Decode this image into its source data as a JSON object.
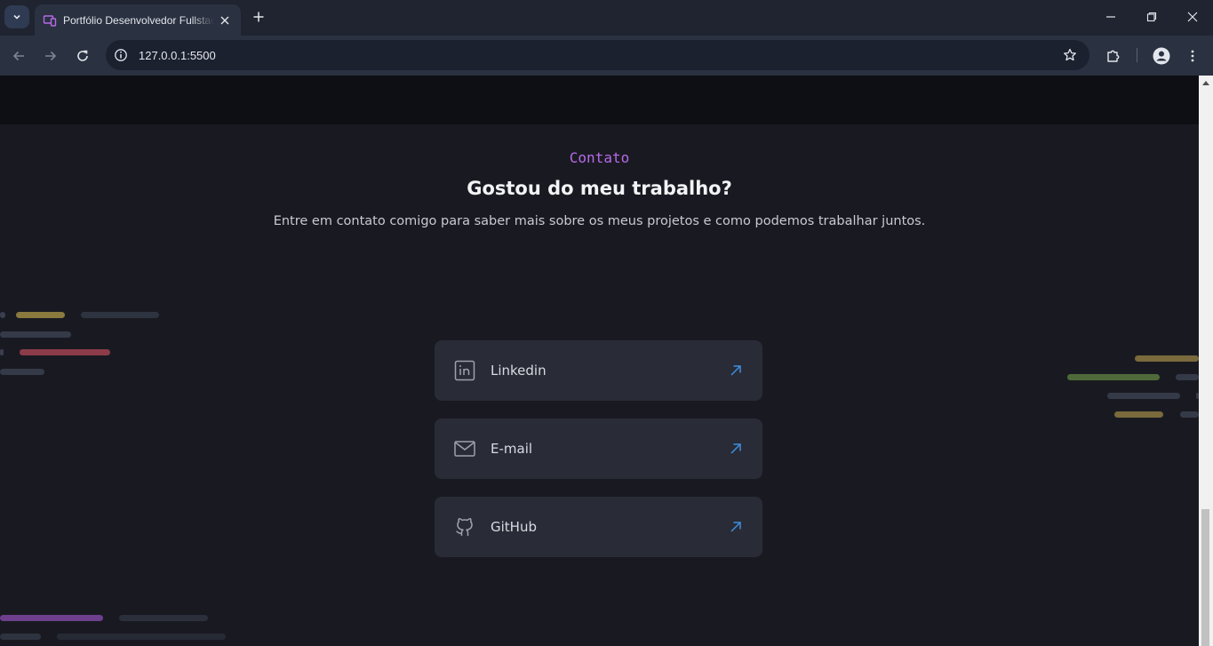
{
  "browser": {
    "tab_title": "Portfólio Desenvolvedor Fullstack",
    "url": "127.0.0.1:5500",
    "accent": "#b66ae8"
  },
  "contact": {
    "eyebrow": "Contato",
    "heading": "Gostou do meu trabalho?",
    "subtext": "Entre em contato comigo para saber mais sobre os meus projetos e como podemos trabalhar juntos.",
    "links": [
      {
        "label": "Linkedin",
        "icon": "linkedin-icon"
      },
      {
        "label": "E-mail",
        "icon": "mail-icon"
      },
      {
        "label": "GitHub",
        "icon": "github-icon"
      }
    ],
    "arrow_color": "#3d8fe0"
  }
}
